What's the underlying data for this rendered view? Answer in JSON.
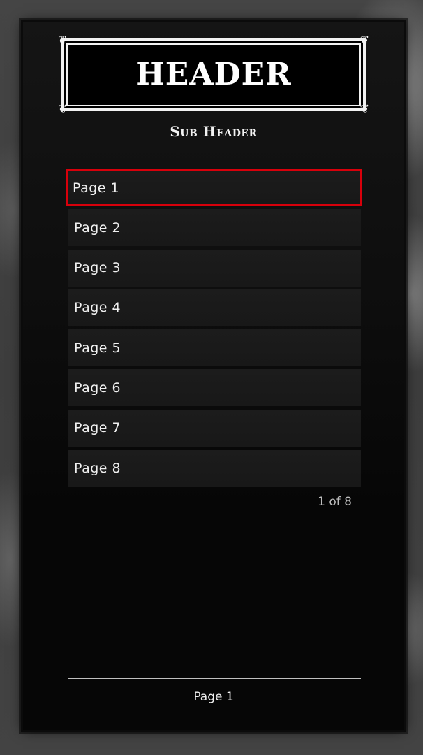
{
  "header": {
    "title": "HEADER",
    "subtitle": "Sub Header"
  },
  "menu": {
    "items": [
      {
        "label": "Page 1"
      },
      {
        "label": "Page 2"
      },
      {
        "label": "Page 3"
      },
      {
        "label": "Page 4"
      },
      {
        "label": "Page 5"
      },
      {
        "label": "Page 6"
      },
      {
        "label": "Page 7"
      },
      {
        "label": "Page 8"
      }
    ],
    "selected_index": 0,
    "counter": "1 of 8"
  },
  "footer": {
    "description": "Page 1"
  },
  "colors": {
    "selection": "#d8000b",
    "panel": "#060606",
    "item_background": "#1c1c1c",
    "text": "#f0f0f0"
  }
}
